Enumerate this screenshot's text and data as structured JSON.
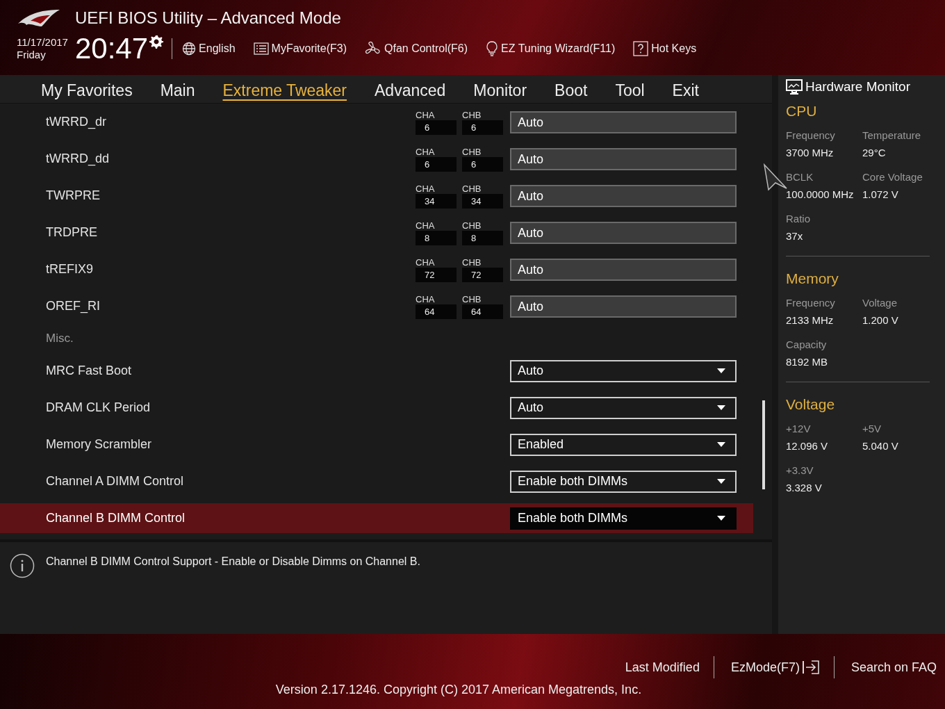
{
  "header": {
    "title": "UEFI BIOS Utility – Advanced Mode",
    "date": "11/17/2017",
    "day": "Friday",
    "time": "20:47",
    "tools": [
      "English",
      "MyFavorite(F3)",
      "Qfan Control(F6)",
      "EZ Tuning Wizard(F11)",
      "Hot Keys"
    ]
  },
  "tabs": [
    {
      "label": "My Favorites",
      "selected": false
    },
    {
      "label": "Main",
      "selected": false
    },
    {
      "label": "Extreme Tweaker",
      "selected": true
    },
    {
      "label": "Advanced",
      "selected": false
    },
    {
      "label": "Monitor",
      "selected": false
    },
    {
      "label": "Boot",
      "selected": false
    },
    {
      "label": "Tool",
      "selected": false
    },
    {
      "label": "Exit",
      "selected": false
    }
  ],
  "settings": [
    {
      "kind": "timing",
      "label": "tWRRD_dr",
      "cha_label": "CHA",
      "cha": "6",
      "chb_label": "CHB",
      "chb": "6",
      "value": "Auto",
      "selected": false
    },
    {
      "kind": "timing",
      "label": "tWRRD_dd",
      "cha_label": "CHA",
      "cha": "6",
      "chb_label": "CHB",
      "chb": "6",
      "value": "Auto",
      "selected": false
    },
    {
      "kind": "timing",
      "label": "TWRPRE",
      "cha_label": "CHA",
      "cha": "34",
      "chb_label": "CHB",
      "chb": "34",
      "value": "Auto",
      "selected": false
    },
    {
      "kind": "timing",
      "label": "TRDPRE",
      "cha_label": "CHA",
      "cha": "8",
      "chb_label": "CHB",
      "chb": "8",
      "value": "Auto",
      "selected": false
    },
    {
      "kind": "timing",
      "label": "tREFIX9",
      "cha_label": "CHA",
      "cha": "72",
      "chb_label": "CHB",
      "chb": "72",
      "value": "Auto",
      "selected": false
    },
    {
      "kind": "timing",
      "label": "OREF_RI",
      "cha_label": "CHA",
      "cha": "64",
      "chb_label": "CHB",
      "chb": "64",
      "value": "Auto",
      "selected": false
    },
    {
      "kind": "heading",
      "label": "Misc."
    },
    {
      "kind": "dropdown",
      "label": "MRC Fast Boot",
      "value": "Auto",
      "selected": false
    },
    {
      "kind": "dropdown",
      "label": "DRAM CLK Period",
      "value": "Auto",
      "selected": false
    },
    {
      "kind": "dropdown",
      "label": "Memory Scrambler",
      "value": "Enabled",
      "selected": false
    },
    {
      "kind": "dropdown",
      "label": "Channel A DIMM Control",
      "value": "Enable both DIMMs",
      "selected": false
    },
    {
      "kind": "dropdown",
      "label": "Channel B DIMM Control",
      "value": "Enable both DIMMs",
      "selected": true
    }
  ],
  "help": "Channel B DIMM Control Support - Enable or Disable Dimms on Channel B.",
  "monitor": {
    "title": "Hardware Monitor",
    "sections": [
      {
        "title": "CPU",
        "items": [
          {
            "label": "Frequency",
            "value": "3700 MHz"
          },
          {
            "label": "Temperature",
            "value": "29°C"
          },
          {
            "label": "BCLK",
            "value": "100.0000 MHz"
          },
          {
            "label": "Core Voltage",
            "value": "1.072 V"
          },
          {
            "label": "Ratio",
            "value": "37x"
          }
        ]
      },
      {
        "title": "Memory",
        "items": [
          {
            "label": "Frequency",
            "value": "2133 MHz"
          },
          {
            "label": "Voltage",
            "value": "1.200 V"
          },
          {
            "label": "Capacity",
            "value": "8192 MB"
          }
        ]
      },
      {
        "title": "Voltage",
        "items": [
          {
            "label": "+12V",
            "value": "12.096 V"
          },
          {
            "label": "+5V",
            "value": "5.040 V"
          },
          {
            "label": "+3.3V",
            "value": "3.328 V"
          }
        ]
      }
    ]
  },
  "footer": {
    "links": [
      "Last Modified",
      "EzMode(F7)",
      "Search on FAQ"
    ],
    "version": "Version 2.17.1246. Copyright (C) 2017 American Megatrends, Inc."
  }
}
